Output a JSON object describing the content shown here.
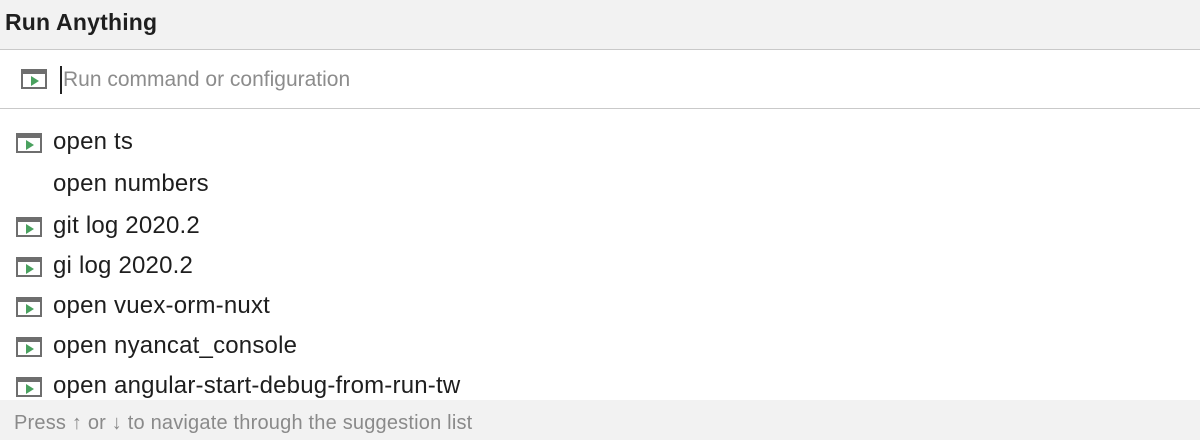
{
  "popup": {
    "title": "Run Anything",
    "search": {
      "icon": "run-configuration-icon",
      "value": "",
      "placeholder": "Run command or configuration"
    },
    "items": [
      {
        "label": "open ts",
        "icon": "run-configuration-icon"
      },
      {
        "label": "open numbers",
        "icon": null
      },
      {
        "label": "git log 2020.2",
        "icon": "run-configuration-icon"
      },
      {
        "label": "gi log 2020.2",
        "icon": "run-configuration-icon"
      },
      {
        "label": "open vuex-orm-nuxt",
        "icon": "run-configuration-icon"
      },
      {
        "label": "open nyancat_console",
        "icon": "run-configuration-icon"
      },
      {
        "label": "open angular-start-debug-from-run-tw",
        "icon": "run-configuration-icon"
      }
    ],
    "footer_hint": "Press ↑ or ↓ to navigate through the suggestion list"
  },
  "colors": {
    "header_bg": "#f2f2f2",
    "separator": "#c9c9c9",
    "run_triangle": "#4aa15f",
    "hint_text": "#8a8a8a"
  }
}
